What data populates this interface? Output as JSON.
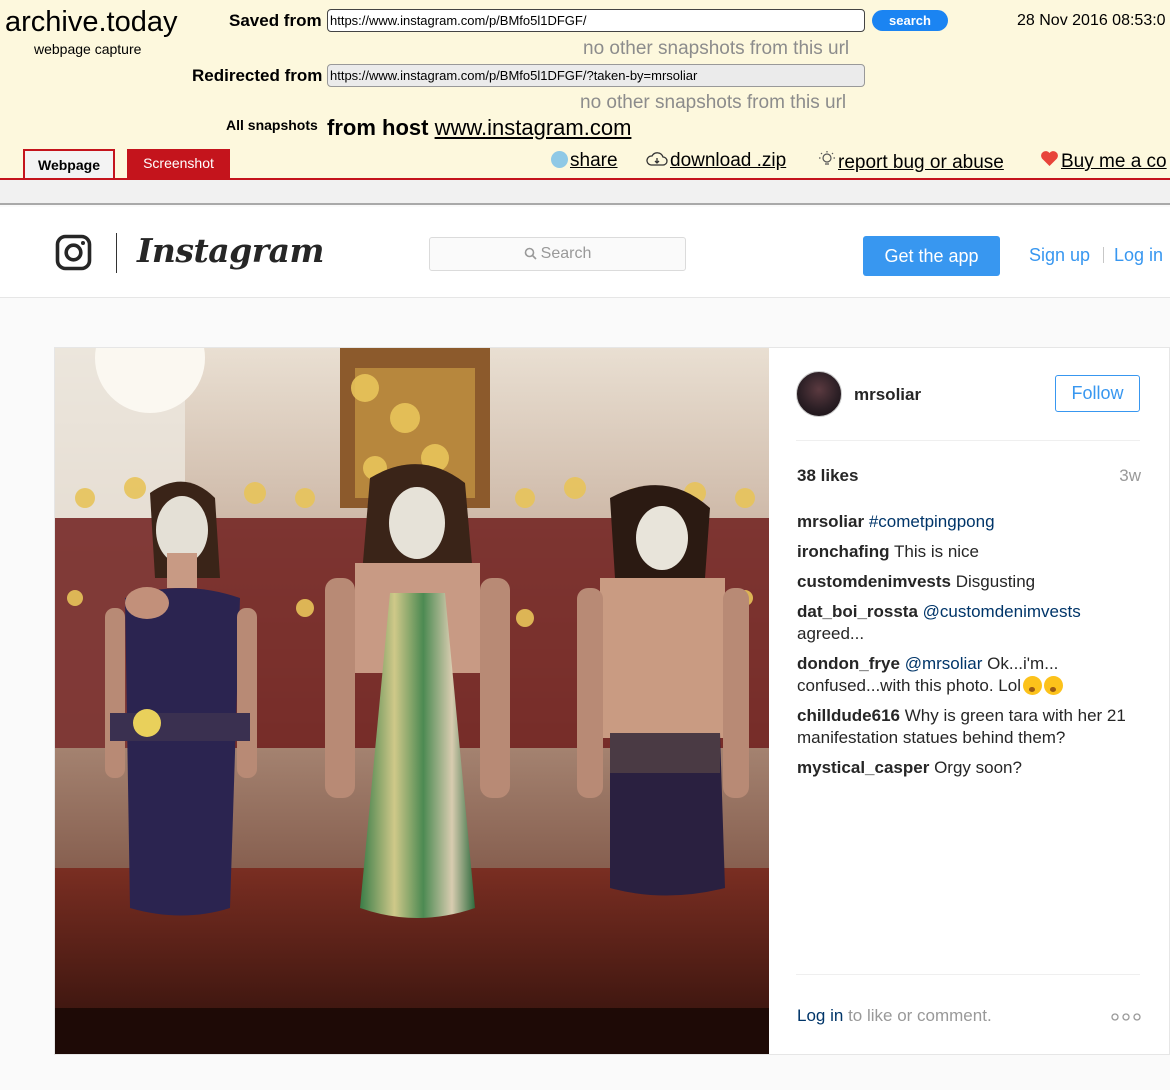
{
  "archive": {
    "logo": "archive.today",
    "logo_sub": "webpage capture",
    "saved_from_label": "Saved from",
    "saved_url": "https://www.instagram.com/p/BMfo5l1DFGF/",
    "search_label": "search",
    "date": "28 Nov 2016 08:53:0",
    "no_snapshots": "no other snapshots from this url",
    "redirected_from_label": "Redirected from",
    "redirected_url": "https://www.instagram.com/p/BMfo5l1DFGF/?taken-by=mrsoliar",
    "all_snapshots_label": "All snapshots",
    "from_host_label": "from host",
    "host": "www.instagram.com",
    "tabs": [
      {
        "label": "Webpage",
        "active": true
      },
      {
        "label": "Screenshot",
        "active": false
      }
    ],
    "actions": {
      "share": "share",
      "download": "download .zip",
      "report": "report bug or abuse",
      "buy": "Buy me a co"
    },
    "colors": {
      "accent_red": "#c4141c",
      "header_bg": "#fdf8dd",
      "search_blue": "#1b84f2"
    }
  },
  "instagram": {
    "wordmark": "Instagram",
    "search_placeholder": "Search",
    "get_app": "Get the app",
    "sign_up": "Sign up",
    "log_in": "Log in",
    "post": {
      "username": "mrsoliar",
      "follow": "Follow",
      "likes": "38 likes",
      "age": "3w",
      "comments": [
        {
          "user": "mrsoliar",
          "tag": "#cometpingpong",
          "text": ""
        },
        {
          "user": "ironchafing",
          "tag": "",
          "text": "This is nice"
        },
        {
          "user": "customdenimvests",
          "tag": "",
          "text": "Disgusting"
        },
        {
          "user": "dat_boi_rossta",
          "tag": "@customdenimvests",
          "text": "agreed..."
        },
        {
          "user": "dondon_frye",
          "tag": "@mrsoliar",
          "text": "Ok...i'm... confused...with this photo. Lol"
        },
        {
          "user": "chilldude616",
          "tag": "",
          "text": "Why is green tara with her 21 manifestation statues behind them?"
        },
        {
          "user": "mystical_casper",
          "tag": "",
          "text": "Orgy soon?"
        }
      ],
      "login_link": "Log in",
      "login_rest": "to like or comment."
    },
    "colors": {
      "blue": "#3897f0",
      "link_dark": "#003569",
      "text": "#262626"
    }
  }
}
